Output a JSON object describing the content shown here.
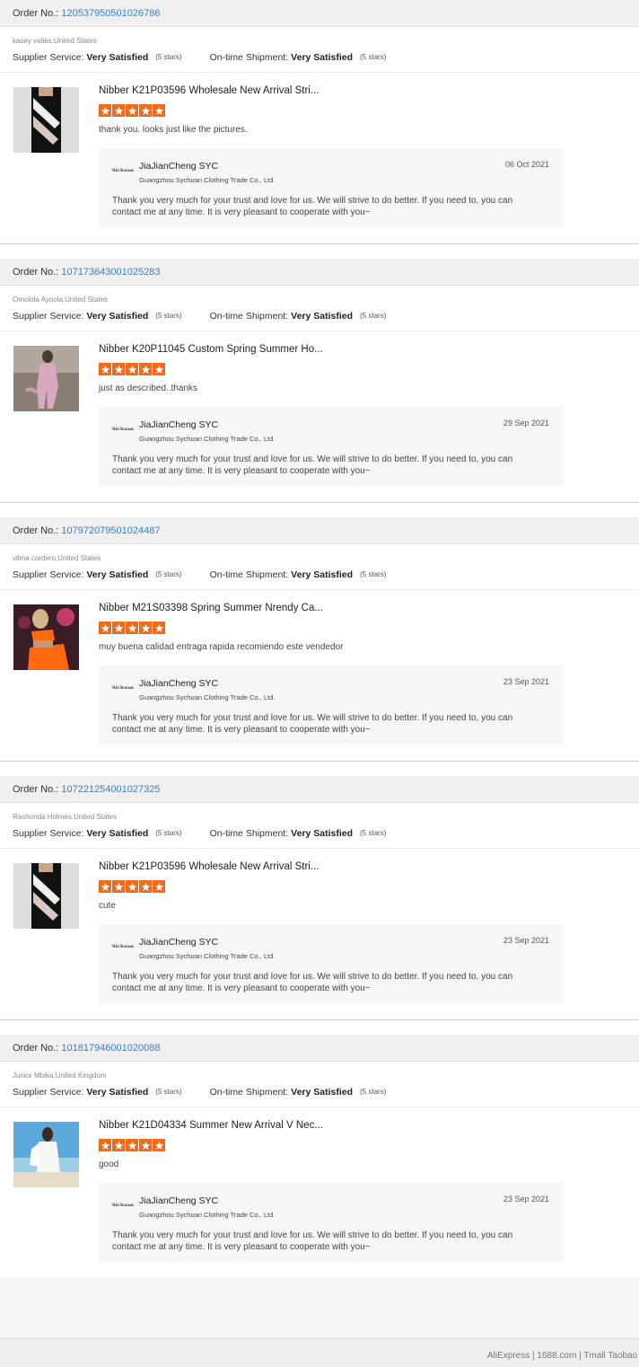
{
  "labels": {
    "order_no": "Order No.:",
    "supplier_service": "Supplier Service:",
    "ontime_shipment": "On-time Shipment:"
  },
  "reviews": [
    {
      "order_no": "120537950501026786",
      "buyer": "kasey valles,United States",
      "supplier_rating": "Very Satisfied",
      "supplier_stars": "(5 stars)",
      "shipment_rating": "Very Satisfied",
      "shipment_stars": "(5 stars)",
      "product_title": "Nibber K21P03596 Wholesale New Arrival Stri...",
      "rating": 5,
      "comment": "thank you. looks just like the pictures.",
      "reply": {
        "seller": "JiaJianCheng SYC",
        "company": "Guangzhou Sychuan Clothing Trade Co., Ltd.",
        "date": "06 Oct 2021",
        "message": "Thank you very much for your trust and love for us. We will strive to do better. If you need to, you can contact me at any time. It is very pleasant to cooperate with you~",
        "logo_text": "Sichuan"
      }
    },
    {
      "order_no": "107173643001025283",
      "buyer": "Omolola Ayoola,United States",
      "supplier_rating": "Very Satisfied",
      "supplier_stars": "(5 stars)",
      "shipment_rating": "Very Satisfied",
      "shipment_stars": "(5 stars)",
      "product_title": "Nibber K20P11045 Custom Spring Summer Ho...",
      "rating": 5,
      "comment": "just as described..thanks",
      "reply": {
        "seller": "JiaJianCheng SYC",
        "company": "Guangzhou Sychuan Clothing Trade Co., Ltd.",
        "date": "29 Sep 2021",
        "message": "Thank you very much for your trust and love for us. We will strive to do better. If you need to, you can contact me at any time. It is very pleasant to cooperate with you~",
        "logo_text": "Sichuan"
      }
    },
    {
      "order_no": "107972079501024487",
      "buyer": "vilma cordero,United States",
      "supplier_rating": "Very Satisfied",
      "supplier_stars": "(5 stars)",
      "shipment_rating": "Very Satisfied",
      "shipment_stars": "(5 stars)",
      "product_title": "Nibber M21S03398 Spring Summer Nrendy Ca...",
      "rating": 5,
      "comment": "muy buena calidad entraga rapida recomiendo este vendedor",
      "reply": {
        "seller": "JiaJianCheng SYC",
        "company": "Guangzhou Sychuan Clothing Trade Co., Ltd.",
        "date": "23 Sep 2021",
        "message": "Thank you very much for your trust and love for us. We will strive to do better. If you need to, you can contact me at any time. It is very pleasant to cooperate with you~",
        "logo_text": "Sichuan"
      }
    },
    {
      "order_no": "107221254001027325",
      "buyer": "Rashonda Holmes,United States",
      "supplier_rating": "Very Satisfied",
      "supplier_stars": "(5 stars)",
      "shipment_rating": "Very Satisfied",
      "shipment_stars": "(5 stars)",
      "product_title": "Nibber K21P03596 Wholesale New Arrival Stri...",
      "rating": 5,
      "comment": "cute",
      "reply": {
        "seller": "JiaJianCheng SYC",
        "company": "Guangzhou Sychuan Clothing Trade Co., Ltd.",
        "date": "23 Sep 2021",
        "message": "Thank you very much for your trust and love for us. We will strive to do better. If you need to, you can contact me at any time. It is very pleasant to cooperate with you~",
        "logo_text": "Sichuan"
      }
    },
    {
      "order_no": "101817946001020088",
      "buyer": "Junior Mbika,United Kingdom",
      "supplier_rating": "Very Satisfied",
      "supplier_stars": "(5 stars)",
      "shipment_rating": "Very Satisfied",
      "shipment_stars": "(5 stars)",
      "product_title": "Nibber K21D04334 Summer New Arrival V Nec...",
      "rating": 5,
      "comment": "good",
      "reply": {
        "seller": "JiaJianCheng SYC",
        "company": "Guangzhou Sychuan Clothing Trade Co., Ltd.",
        "date": "23 Sep 2021",
        "message": "Thank you very much for your trust and love for us. We will strive to do better. If you need to, you can contact me at any time. It is very pleasant to cooperate with you~",
        "logo_text": "Sichuan"
      }
    }
  ],
  "footer": {
    "links": "AliExpress | 1688.com | Tmall Taobao"
  },
  "colors": {
    "star": "#f26b1d",
    "order_link": "#3b7dc4",
    "reply_bg": "#f5f7f9"
  },
  "icons": {
    "star": "star-icon",
    "thumbnail": "product-thumbnail"
  }
}
